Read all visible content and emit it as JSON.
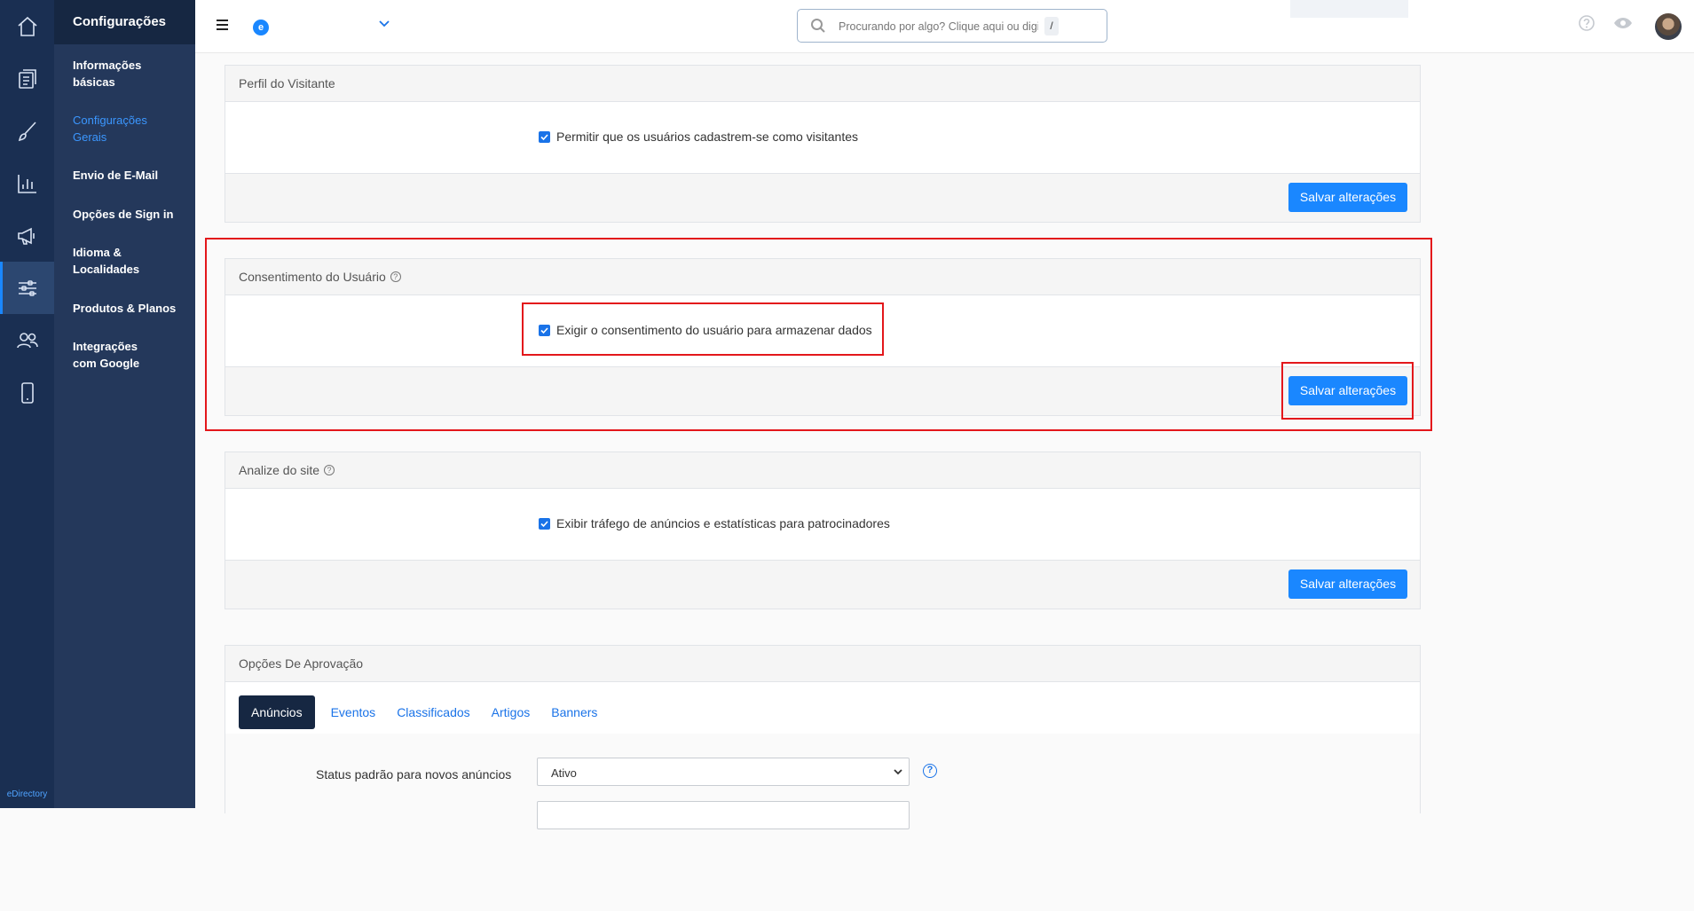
{
  "rail": {
    "items": [
      {
        "icon": "home-icon"
      },
      {
        "icon": "pages-icon"
      },
      {
        "icon": "brush-icon"
      },
      {
        "icon": "chart-icon"
      },
      {
        "icon": "megaphone-icon"
      },
      {
        "icon": "sliders-icon"
      },
      {
        "icon": "users-icon"
      },
      {
        "icon": "mobile-icon"
      }
    ],
    "footer": "eDirectory"
  },
  "subnav": {
    "title": "Configurações",
    "items": [
      {
        "label": "Informações básicas"
      },
      {
        "label": "Configurações Gerais"
      },
      {
        "label": "Envio de E-Mail"
      },
      {
        "label": "Opções de Sign in"
      },
      {
        "label": "Idioma & Localidades"
      },
      {
        "label": "Produtos & Planos"
      },
      {
        "label": "Integrações com Google"
      }
    ]
  },
  "topbar": {
    "site_logo_letter": "e",
    "search_placeholder": "Procurando por algo? Clique aqui ou digite",
    "search_shortcut": "/"
  },
  "panels": {
    "visitor": {
      "title": "Perfil do Visitante",
      "checkbox_label": "Permitir que os usuários cadastrem-se como visitantes",
      "checked": true,
      "save_label": "Salvar alterações"
    },
    "consent": {
      "title": "Consentimento do Usuário",
      "checkbox_label": "Exigir o consentimento do usuário para armazenar dados",
      "checked": true,
      "save_label": "Salvar alterações"
    },
    "analytics": {
      "title": "Analize do site",
      "checkbox_label": "Exibir tráfego de anúncios e estatísticas para patrocinadores",
      "checked": true,
      "save_label": "Salvar alterações"
    },
    "approval": {
      "title": "Opções De Aprovação",
      "tabs": [
        {
          "label": "Anúncios"
        },
        {
          "label": "Eventos"
        },
        {
          "label": "Classificados"
        },
        {
          "label": "Artigos"
        },
        {
          "label": "Banners"
        }
      ],
      "field_label": "Status padrão para novos anúncios",
      "field_value": "Ativo"
    }
  },
  "colors": {
    "accent": "#1a87ff",
    "rail_bg": "#1a2f52",
    "subnav_bg": "#24385b",
    "highlight": "#e3171b"
  }
}
